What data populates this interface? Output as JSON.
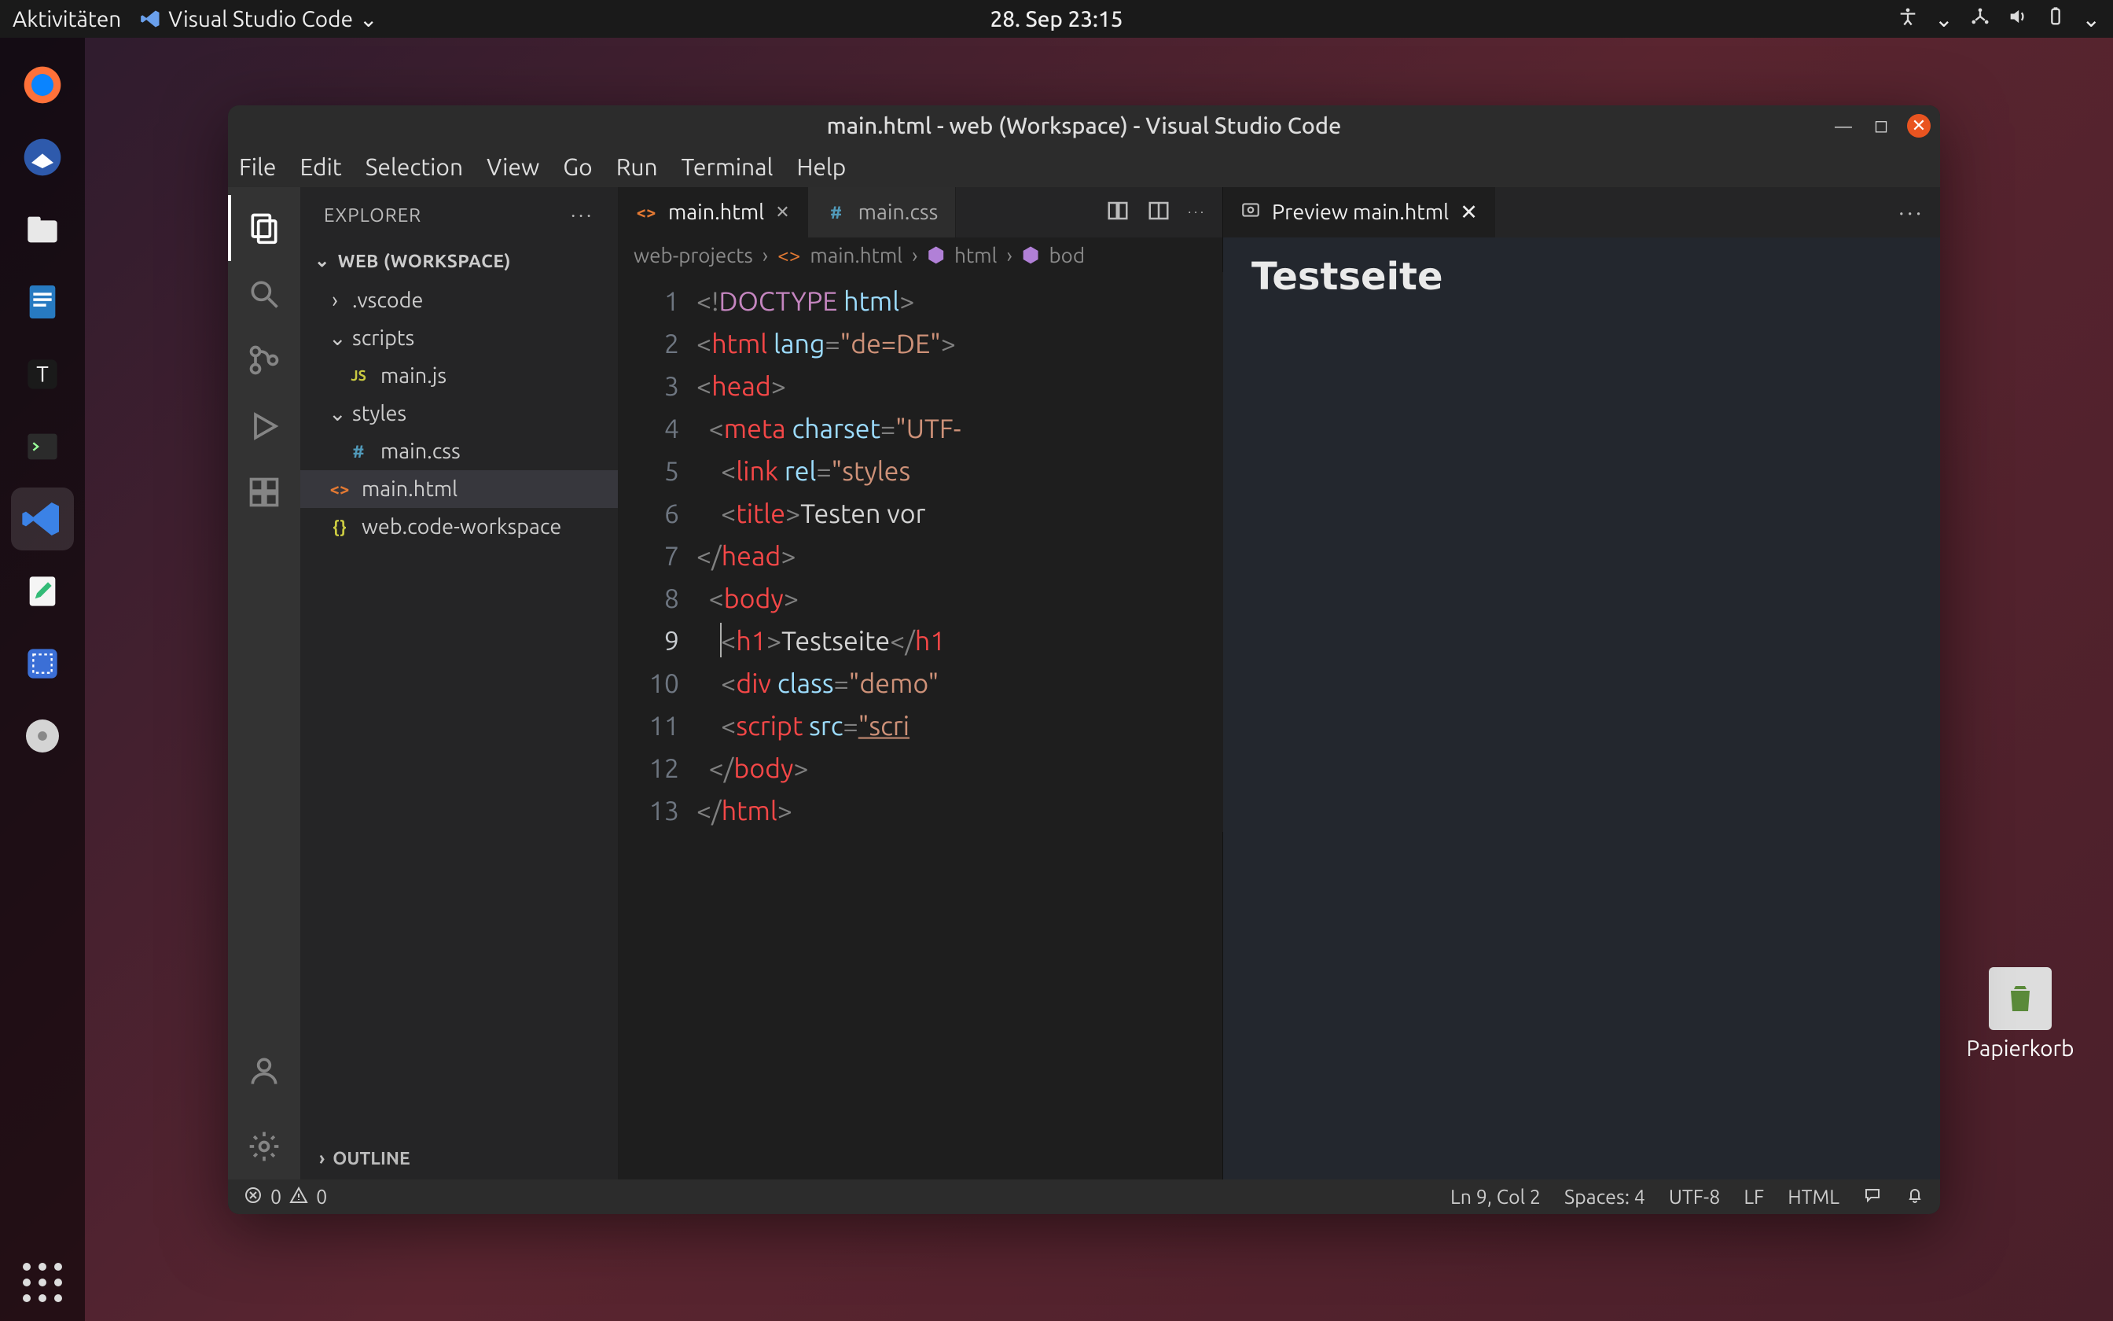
{
  "topbar": {
    "activities": "Aktivitäten",
    "app_name": "Visual Studio Code",
    "clock": "28. Sep  23:15"
  },
  "desktop": {
    "trash_label": "Papierkorb"
  },
  "vscode": {
    "title": "main.html - web (Workspace) - Visual Studio Code",
    "menu": [
      "File",
      "Edit",
      "Selection",
      "View",
      "Go",
      "Run",
      "Terminal",
      "Help"
    ],
    "explorer": {
      "title": "EXPLORER",
      "workspace_label": "WEB (WORKSPACE)",
      "items": [
        {
          "type": "folder",
          "chev": "›",
          "name": ".vscode",
          "indent": 0
        },
        {
          "type": "folder",
          "chev": "⌄",
          "name": "scripts",
          "indent": 0
        },
        {
          "type": "file",
          "icon": "JS",
          "cls": "js-ico",
          "name": "main.js",
          "indent": 1
        },
        {
          "type": "folder",
          "chev": "⌄",
          "name": "styles",
          "indent": 0
        },
        {
          "type": "file",
          "icon": "#",
          "cls": "css-ico",
          "name": "main.css",
          "indent": 1
        },
        {
          "type": "file",
          "icon": "<>",
          "cls": "html-ico",
          "name": "main.html",
          "indent": 0,
          "selected": true
        },
        {
          "type": "file",
          "icon": "{}",
          "cls": "json-ico",
          "name": "web.code-workspace",
          "indent": 0
        }
      ],
      "outline_label": "OUTLINE"
    },
    "tabs": {
      "left": [
        {
          "icon": "<>",
          "cls": "html-ico",
          "label": "main.html",
          "active": true,
          "close": true
        },
        {
          "icon": "#",
          "cls": "css-ico",
          "label": "main.css",
          "active": false,
          "close": false
        }
      ],
      "preview": {
        "label": "Preview main.html"
      }
    },
    "breadcrumb": [
      "web-projects",
      "main.html",
      "html",
      "bod"
    ],
    "code_lines": [
      {
        "n": 1,
        "html": "<span class='tk-punct'>&lt;!</span><span class='tk-doctype'>DOCTYPE</span> <span class='tk-attr'>html</span><span class='tk-punct'>&gt;</span>"
      },
      {
        "n": 2,
        "html": "<span class='tk-punct'>&lt;</span><span class='tk-tag'>html</span> <span class='tk-attr'>lang</span><span class='tk-punct'>=</span><span class='tk-str'>\"de=DE\"</span><span class='tk-punct'>&gt;</span>"
      },
      {
        "n": 3,
        "html": "<span class='tk-punct'>&lt;</span><span class='tk-tag'>head</span><span class='tk-punct'>&gt;</span>"
      },
      {
        "n": 4,
        "html": "  <span class='tk-punct'>&lt;</span><span class='tk-tag'>meta</span> <span class='tk-attr'>charset</span><span class='tk-punct'>=</span><span class='tk-str'>\"UTF-</span>"
      },
      {
        "n": 5,
        "html": "    <span class='tk-punct'>&lt;</span><span class='tk-tag'>link</span> <span class='tk-attr'>rel</span><span class='tk-punct'>=</span><span class='tk-str'>\"styles</span>"
      },
      {
        "n": 6,
        "html": "    <span class='tk-punct'>&lt;</span><span class='tk-tag'>title</span><span class='tk-punct'>&gt;</span><span class='tk-text'>Testen vor</span>"
      },
      {
        "n": 7,
        "html": "<span class='tk-punct'>&lt;/</span><span class='tk-tag'>head</span><span class='tk-punct'>&gt;</span>"
      },
      {
        "n": 8,
        "html": "  <span class='tk-punct'>&lt;</span><span class='tk-tag'>body</span><span class='tk-punct'>&gt;</span>"
      },
      {
        "n": 9,
        "html": "    <span class='tk-punct'>&lt;</span><span class='tk-tag'>h1</span><span class='tk-punct'>&gt;</span><span class='tk-text'>Testseite</span><span class='tk-punct'>&lt;/</span><span class='tk-tag'>h1</span>",
        "current": true
      },
      {
        "n": 10,
        "html": "    <span class='tk-punct'>&lt;</span><span class='tk-tag'>div</span> <span class='tk-attr'>class</span><span class='tk-punct'>=</span><span class='tk-str'>\"demo\"</span>"
      },
      {
        "n": 11,
        "html": "    <span class='tk-punct'>&lt;</span><span class='tk-tag'>script</span> <span class='tk-attr'>src</span><span class='tk-punct'>=</span><span class='tk-link'>\"scri</span>"
      },
      {
        "n": 12,
        "html": "  <span class='tk-punct'>&lt;/</span><span class='tk-tag'>body</span><span class='tk-punct'>&gt;</span>"
      },
      {
        "n": 13,
        "html": "<span class='tk-punct'>&lt;/</span><span class='tk-tag'>html</span><span class='tk-punct'>&gt;</span>"
      }
    ],
    "preview_heading": "Testseite",
    "status": {
      "errors": "0",
      "warnings": "0",
      "cursor": "Ln 9, Col 2",
      "spaces": "Spaces: 4",
      "encoding": "UTF-8",
      "eol": "LF",
      "lang": "HTML"
    }
  }
}
